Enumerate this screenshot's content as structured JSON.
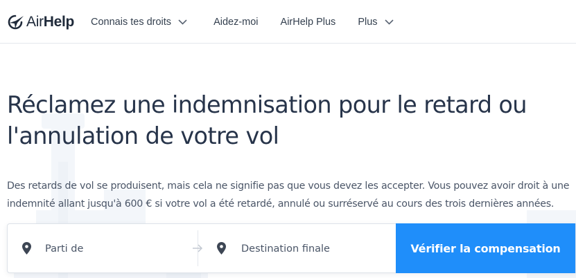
{
  "brand": {
    "logo_icon": "airhelp-plane-icon",
    "name_regular": "Air",
    "name_bold": "Help",
    "primary_color": "#1f8efa",
    "text_color": "#27344a"
  },
  "nav": {
    "items": [
      {
        "label": "Connais tes droits",
        "has_dropdown": true
      },
      {
        "label": "Aidez-moi",
        "has_dropdown": false
      },
      {
        "label": "AirHelp Plus",
        "has_dropdown": false
      },
      {
        "label": "Plus",
        "has_dropdown": true
      }
    ]
  },
  "hero": {
    "title_line1": "Réclamez une indemnisation pour le retard ou",
    "title_line2": "l'annulation de votre vol",
    "description_line1": "Des retards de vol se produisent, mais cela ne signifie pas que vous devez les accepter. Vous pouvez avoir droit à une",
    "description_line2": "indemnité allant jusqu'à 600 € si votre vol a été retardé, annulé ou surréservé au cours des trois dernières années."
  },
  "search": {
    "from": {
      "placeholder": "Parti de",
      "value": "",
      "icon": "location-pin-icon"
    },
    "to": {
      "placeholder": "Destination finale",
      "value": "",
      "icon": "location-pin-icon"
    },
    "swap_icon": "arrow-right-icon",
    "submit_label": "Vérifier la compensation"
  }
}
